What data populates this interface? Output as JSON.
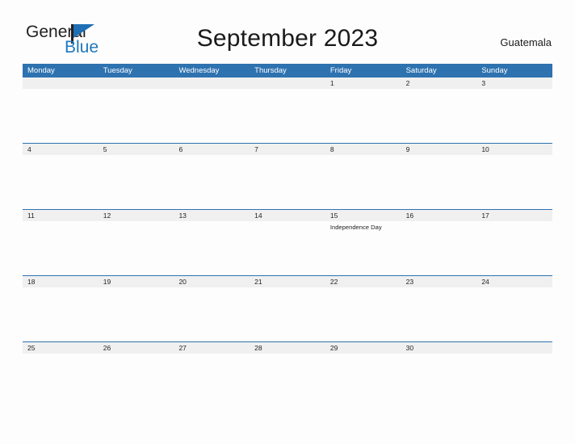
{
  "brand": {
    "name_part1": "General",
    "name_part2": "Blue",
    "flag_icon": "flag-triangle-icon",
    "color_dark": "#231f20",
    "color_blue": "#1f77bd"
  },
  "header": {
    "title": "September 2023",
    "country": "Guatemala"
  },
  "theme": {
    "header_blue": "#2e72b0",
    "band_gray": "#f0f0f0",
    "page_background": "#fdfdfd",
    "rule_blue": "#2e72b0"
  },
  "calendar": {
    "month": "September",
    "year": "2023",
    "weekday_headers": [
      "Monday",
      "Tuesday",
      "Wednesday",
      "Thursday",
      "Friday",
      "Saturday",
      "Sunday"
    ],
    "weeks": [
      {
        "days": [
          {
            "date": "",
            "event": ""
          },
          {
            "date": "",
            "event": ""
          },
          {
            "date": "",
            "event": ""
          },
          {
            "date": "",
            "event": ""
          },
          {
            "date": "1",
            "event": ""
          },
          {
            "date": "2",
            "event": ""
          },
          {
            "date": "3",
            "event": ""
          }
        ]
      },
      {
        "days": [
          {
            "date": "4",
            "event": ""
          },
          {
            "date": "5",
            "event": ""
          },
          {
            "date": "6",
            "event": ""
          },
          {
            "date": "7",
            "event": ""
          },
          {
            "date": "8",
            "event": ""
          },
          {
            "date": "9",
            "event": ""
          },
          {
            "date": "10",
            "event": ""
          }
        ]
      },
      {
        "days": [
          {
            "date": "11",
            "event": ""
          },
          {
            "date": "12",
            "event": ""
          },
          {
            "date": "13",
            "event": ""
          },
          {
            "date": "14",
            "event": ""
          },
          {
            "date": "15",
            "event": "Independence Day"
          },
          {
            "date": "16",
            "event": ""
          },
          {
            "date": "17",
            "event": ""
          }
        ]
      },
      {
        "days": [
          {
            "date": "18",
            "event": ""
          },
          {
            "date": "19",
            "event": ""
          },
          {
            "date": "20",
            "event": ""
          },
          {
            "date": "21",
            "event": ""
          },
          {
            "date": "22",
            "event": ""
          },
          {
            "date": "23",
            "event": ""
          },
          {
            "date": "24",
            "event": ""
          }
        ]
      },
      {
        "days": [
          {
            "date": "25",
            "event": ""
          },
          {
            "date": "26",
            "event": ""
          },
          {
            "date": "27",
            "event": ""
          },
          {
            "date": "28",
            "event": ""
          },
          {
            "date": "29",
            "event": ""
          },
          {
            "date": "30",
            "event": ""
          },
          {
            "date": "",
            "event": ""
          }
        ]
      }
    ]
  }
}
